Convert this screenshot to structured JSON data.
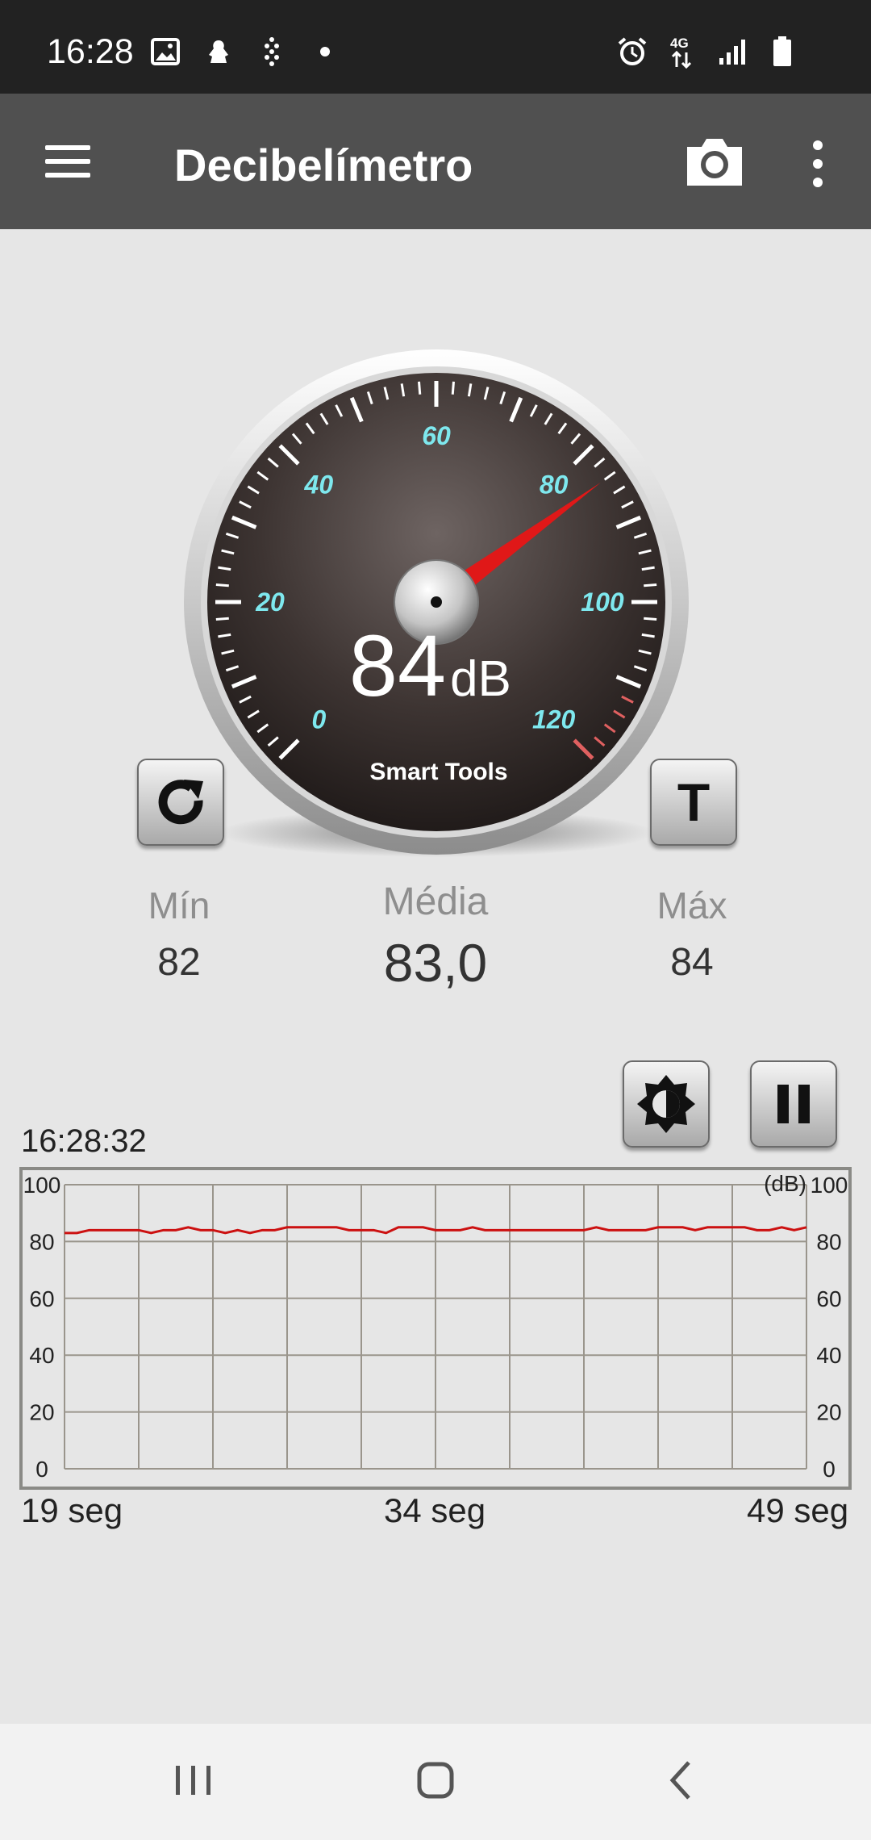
{
  "status_bar": {
    "time": "16:28",
    "network": "4G",
    "icons_left": [
      "gallery-icon",
      "app-notification-icon",
      "activity-icon",
      "dot-icon"
    ],
    "icons_right": [
      "alarm-icon",
      "network-4g-icon",
      "signal-icon",
      "battery-icon"
    ]
  },
  "app_bar": {
    "title": "Decibelímetro",
    "icons": [
      "menu-icon",
      "camera-icon",
      "more-vert-icon"
    ]
  },
  "gauge": {
    "value": 84,
    "unit": "dB",
    "brand": "Smart Tools",
    "min_scale": 0,
    "max_scale": 120,
    "tick_labels": [
      "0",
      "20",
      "40",
      "60",
      "80",
      "100",
      "120"
    ],
    "needle_value": 84,
    "colors": {
      "face": "#3a302e",
      "label": "#7ee8ee",
      "needle": "#e01818",
      "danger_ticks": "#e06060"
    }
  },
  "buttons": {
    "reset": "reset-icon",
    "text_mode": "T",
    "brightness": "brightness-icon",
    "pause": "pause-icon"
  },
  "stats": {
    "min_label": "Mín",
    "min_value": "82",
    "avg_label": "Média",
    "avg_value": "83,0",
    "max_label": "Máx",
    "max_value": "84"
  },
  "chart_data": {
    "type": "line",
    "title": "16:28:32",
    "unit_label": "(dB)",
    "ylim": [
      0,
      100
    ],
    "yticks": [
      "0",
      "20",
      "40",
      "60",
      "80",
      "100"
    ],
    "x_labels": [
      "19 seg",
      "34 seg",
      "49 seg"
    ],
    "grid": true,
    "series": [
      {
        "color": "#cc1111",
        "values": [
          83,
          83,
          84,
          84,
          84,
          84,
          84,
          83,
          84,
          84,
          85,
          84,
          84,
          83,
          84,
          83,
          84,
          84,
          85,
          85,
          85,
          85,
          85,
          84,
          84,
          84,
          83,
          85,
          85,
          85,
          84,
          84,
          84,
          85,
          84,
          84,
          84,
          84,
          84,
          84,
          84,
          84,
          84,
          85,
          84,
          84,
          84,
          84,
          85,
          85,
          85,
          84,
          85,
          85,
          85,
          85,
          84,
          84,
          85,
          84,
          85
        ]
      }
    ]
  },
  "nav_bar": {
    "icons": [
      "recent-apps-icon",
      "home-icon",
      "back-icon"
    ]
  }
}
